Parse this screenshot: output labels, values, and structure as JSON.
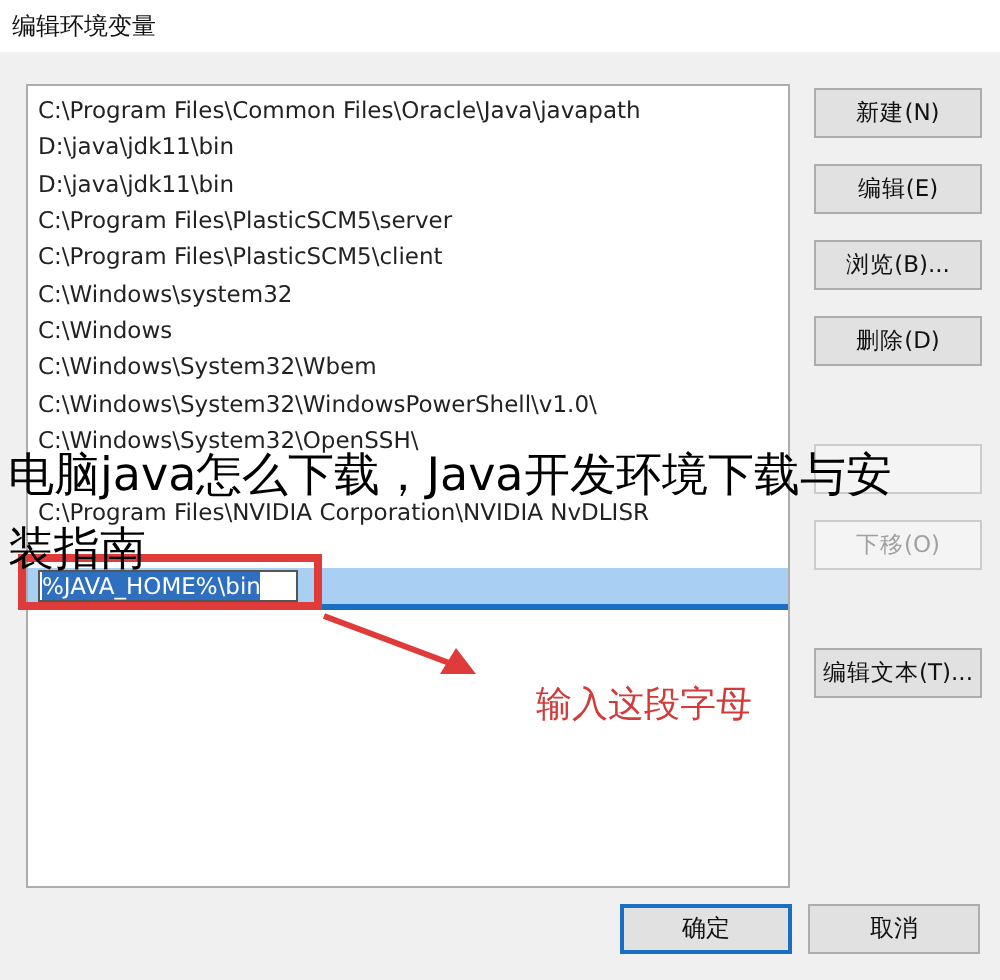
{
  "window": {
    "title": "编辑环境变量"
  },
  "paths": [
    {
      "text": "C:\\Program Files\\Common Files\\Oracle\\Java\\javapath",
      "selected": false
    },
    {
      "text": "D:\\java\\jdk11\\bin",
      "selected": false
    },
    {
      "text": "D:\\java\\jdk11\\bin",
      "selected": false
    },
    {
      "text": "C:\\Program Files\\PlasticSCM5\\server",
      "selected": false
    },
    {
      "text": "C:\\Program Files\\PlasticSCM5\\client",
      "selected": false
    },
    {
      "text": "C:\\Windows\\system32",
      "selected": false
    },
    {
      "text": "C:\\Windows",
      "selected": false
    },
    {
      "text": "C:\\Windows\\System32\\Wbem",
      "selected": false
    },
    {
      "text": "C:\\Windows\\System32\\WindowsPowerShell\\v1.0\\",
      "selected": false
    },
    {
      "text": "C:\\Windows\\System32\\OpenSSH\\",
      "selected": false
    },
    {
      "selected": false
    },
    {
      "text": "C:\\Program Files\\NVIDIA Corporation\\NVIDIA NvDLISR",
      "selected": false
    },
    {
      "selected": false
    },
    {
      "text": "%JAVA_HOME%\\bin",
      "selected": true
    }
  ],
  "side_buttons": [
    {
      "label": "新建(N)",
      "disabled": false
    },
    {
      "label": "编辑(E)",
      "disabled": false
    },
    {
      "label": "浏览(B)...",
      "disabled": false
    },
    {
      "label": "删除(D)",
      "disabled": false
    },
    {
      "disabled": true
    },
    {
      "label": "下移(O)",
      "disabled": true
    },
    {
      "label": "编辑文本(T)...",
      "disabled": false
    }
  ],
  "footer_buttons": [
    {
      "label": "确定",
      "selected": true
    },
    {
      "label": "取消",
      "selected": false
    }
  ],
  "callout": {
    "text": "输入这段字母"
  },
  "caption_lines": [
    "电脑java怎么下载，Java开发环境下载与安",
    "装指南"
  ]
}
